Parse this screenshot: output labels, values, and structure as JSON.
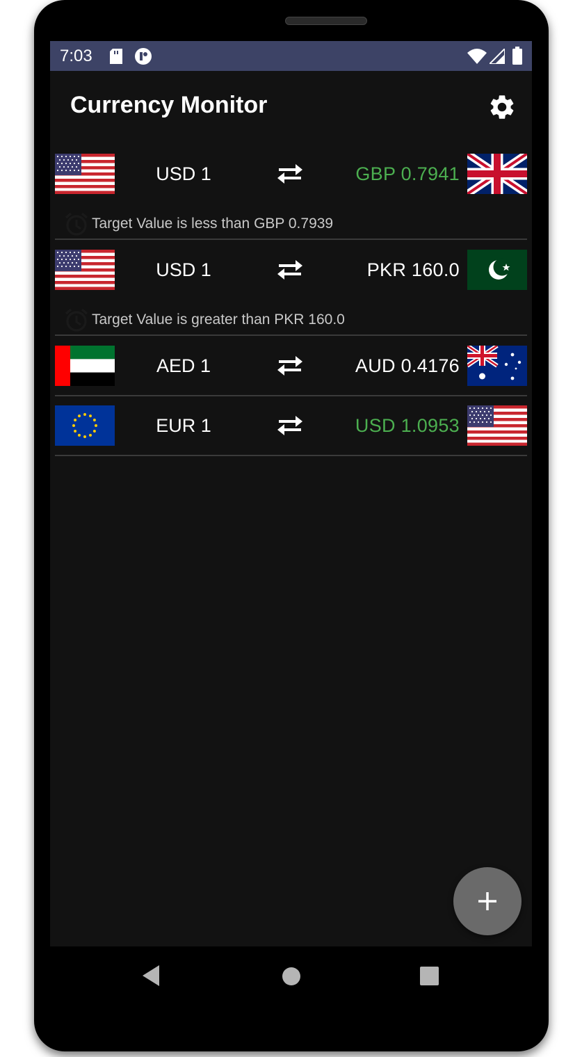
{
  "status_bar": {
    "time": "7:03"
  },
  "app_bar": {
    "title": "Currency Monitor",
    "settings_icon": "gear-icon"
  },
  "colors": {
    "up": "#4caf50",
    "neutral": "#ffffff",
    "status_bar": "#3d4366",
    "fab": "#6a6a6a"
  },
  "rows": [
    {
      "base": {
        "label": "USD 1",
        "flag": "us"
      },
      "quote": {
        "label": "GBP 0.7941",
        "flag": "gb",
        "trend": "up"
      },
      "alert": {
        "text": "Target Value  is less than GBP 0.7939",
        "icon": "alarm-icon"
      }
    },
    {
      "base": {
        "label": "USD 1",
        "flag": "us"
      },
      "quote": {
        "label": "PKR 160.0",
        "flag": "pk",
        "trend": "neutral"
      },
      "alert": {
        "text": "Target Value  is greater than PKR 160.0",
        "icon": "alarm-icon"
      }
    },
    {
      "base": {
        "label": "AED 1",
        "flag": "ae"
      },
      "quote": {
        "label": "AUD 0.4176",
        "flag": "au",
        "trend": "neutral"
      }
    },
    {
      "base": {
        "label": "EUR 1",
        "flag": "eu"
      },
      "quote": {
        "label": "USD 1.0953",
        "flag": "us",
        "trend": "up"
      }
    }
  ],
  "fab": {
    "icon": "plus-icon"
  },
  "nav_bar": {
    "back_icon": "back-icon",
    "home_icon": "home-icon",
    "recents_icon": "recents-icon"
  }
}
